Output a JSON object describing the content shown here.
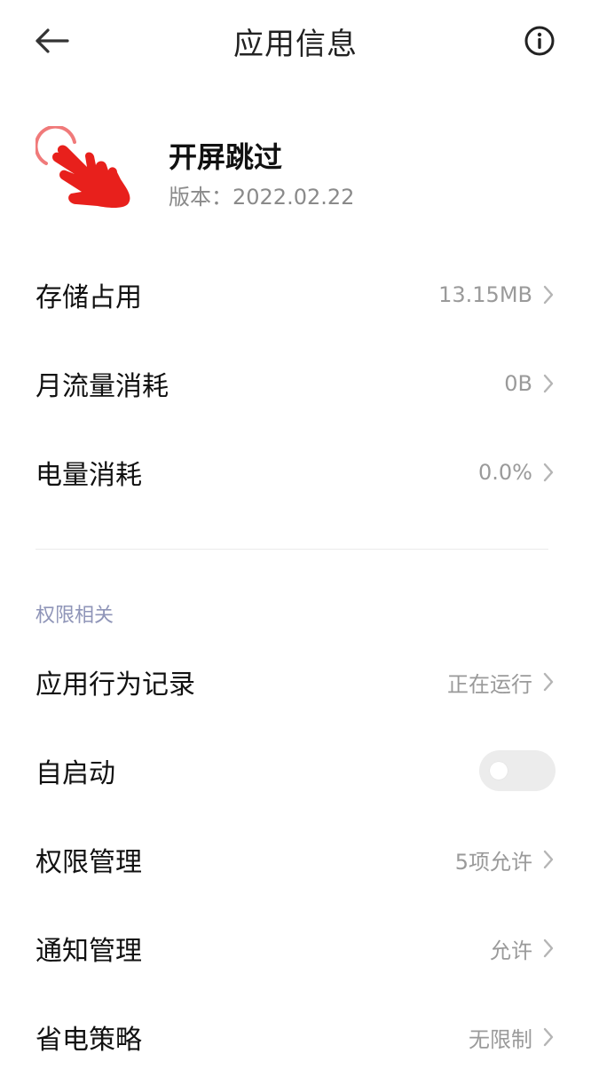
{
  "header": {
    "title": "应用信息",
    "back_icon": "back-arrow-icon",
    "info_icon": "info-circle-icon"
  },
  "app": {
    "name": "开屏跳过",
    "version_label": "版本：",
    "version": "2022.02.22",
    "icon": "tap-hand-icon"
  },
  "usage": [
    {
      "label": "存储占用",
      "value": "13.15MB"
    },
    {
      "label": "月流量消耗",
      "value": "0B"
    },
    {
      "label": "电量消耗",
      "value": "0.0%"
    }
  ],
  "permissions_section": {
    "title": "权限相关",
    "behavior_record": {
      "label": "应用行为记录",
      "value": "正在运行"
    },
    "autostart": {
      "label": "自启动",
      "enabled": false
    },
    "permission_manage": {
      "label": "权限管理",
      "value": "5项允许"
    },
    "notification_manage": {
      "label": "通知管理",
      "value": "允许"
    },
    "power_strategy": {
      "label": "省电策略",
      "value": "无限制"
    }
  },
  "colors": {
    "accent_section": "#8f95b8",
    "icon_red": "#e8201c",
    "text_secondary": "#9a9a9a"
  }
}
